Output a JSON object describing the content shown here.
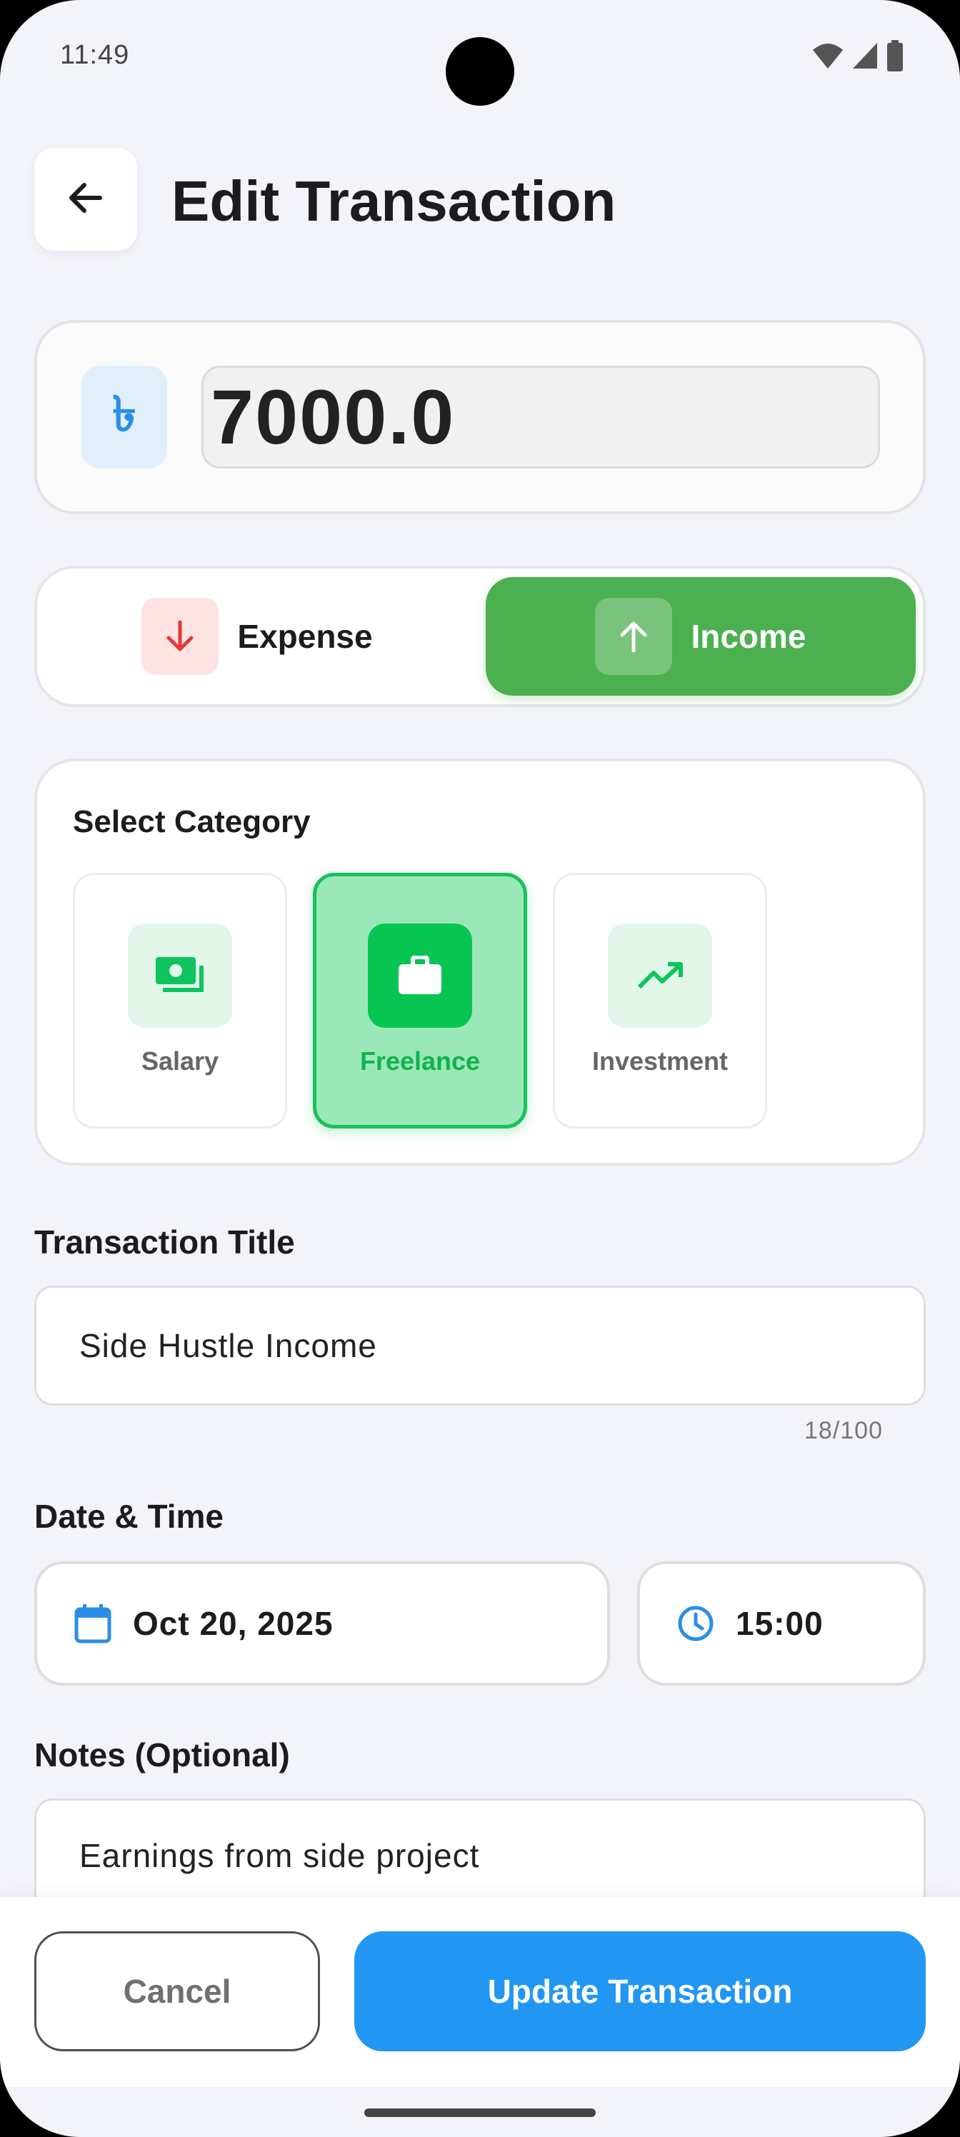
{
  "status_bar": {
    "time": "11:49"
  },
  "header": {
    "title": "Edit Transaction"
  },
  "amount": {
    "currency_symbol": "৳",
    "value": "7000.0"
  },
  "type_toggle": {
    "selected": "Income",
    "expense_label": "Expense",
    "income_label": "Income"
  },
  "category": {
    "heading": "Select Category",
    "selected": "Freelance",
    "items": [
      {
        "label": "Salary",
        "icon": "money-icon"
      },
      {
        "label": "Freelance",
        "icon": "briefcase-icon"
      },
      {
        "label": "Investment",
        "icon": "trending-up-icon"
      }
    ]
  },
  "title_field": {
    "label": "Transaction Title",
    "value": "Side Hustle Income",
    "counter": "18/100"
  },
  "datetime": {
    "label": "Date & Time",
    "date": "Oct 20, 2025",
    "time": "15:00"
  },
  "notes": {
    "label": "Notes (Optional)",
    "value": "Earnings from side project"
  },
  "actions": {
    "cancel_label": "Cancel",
    "update_label": "Update Transaction"
  },
  "colors": {
    "background": "#f3f4f9",
    "income_green": "#4caf50",
    "category_green": "#06c553",
    "expense_red": "#e53935",
    "primary_blue": "#2196f3"
  }
}
